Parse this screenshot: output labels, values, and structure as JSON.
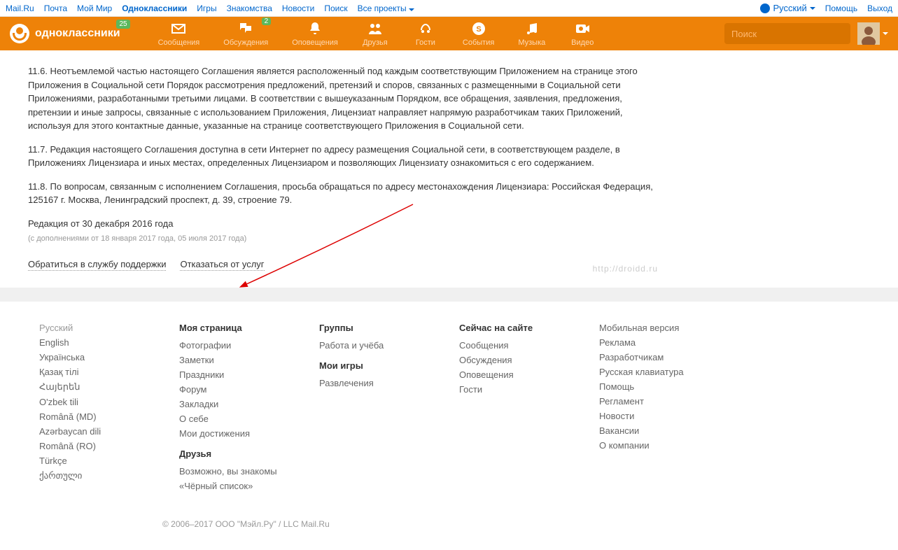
{
  "topbar": {
    "left": [
      "Mail.Ru",
      "Почта",
      "Мой Мир",
      "Одноклассники",
      "Игры",
      "Знакомства",
      "Новости",
      "Поиск",
      "Все проекты"
    ],
    "active_index": 3,
    "dropdown_index": 8,
    "right": {
      "lang": "Русский",
      "help": "Помощь",
      "exit": "Выход"
    }
  },
  "header": {
    "logo_text": "одноклассники",
    "logo_badge": "25",
    "nav": [
      {
        "label": "Сообщения",
        "icon": "mail",
        "badge": null
      },
      {
        "label": "Обсуждения",
        "icon": "chat",
        "badge": "2"
      },
      {
        "label": "Оповещения",
        "icon": "bell",
        "badge": null
      },
      {
        "label": "Друзья",
        "icon": "friends",
        "badge": null
      },
      {
        "label": "Гости",
        "icon": "guests",
        "badge": null
      },
      {
        "label": "События",
        "icon": "events",
        "badge": null
      },
      {
        "label": "Музыка",
        "icon": "music",
        "badge": null
      },
      {
        "label": "Видео",
        "icon": "video",
        "badge": null
      }
    ],
    "search_placeholder": "Поиск"
  },
  "content": {
    "paragraphs": [
      "11.6. Неотъемлемой частью настоящего Соглашения является расположенный под каждым соответствующим Приложением на странице этого Приложения в Социальной сети Порядок рассмотрения предложений, претензий и споров, связанных с размещенными в Социальной сети Приложениями, разработанными третьими лицами. В соответствии с вышеуказанным Порядком, все обращения, заявления, предложения, претензии и иные запросы, связанные с использованием Приложения, Лицензиат направляет напрямую разработчикам таких Приложений, используя для этого контактные данные, указанные на странице соответствующего Приложения в Социальной сети.",
      "11.7. Редакция настоящего Соглашения доступна в сети Интернет по адресу размещения Социальной сети, в соответствующем разделе, в Приложениях Лицензиара и иных местах, определенных Лицензиаром и позволяющих Лицензиату ознакомиться с его содержанием.",
      "11.8. По вопросам, связанным с исполнением Соглашения, просьба обращаться по адресу местонахождения Лицензиара: Российская Федерация, 125167 г. Москва, Ленинградский проспект, д. 39, строение 79."
    ],
    "date_main": "Редакция от 30 декабря 2016 года",
    "date_sub": "(с дополнениями от 18 января 2017 года, 05 июля 2017 года)",
    "actions": [
      "Обратиться в службу поддержки",
      "Отказаться от услуг"
    ],
    "watermark": "http://droidd.ru"
  },
  "footer": {
    "col1": {
      "current": "Русский",
      "links": [
        "English",
        "Українська",
        "Қазақ тілі",
        "Հայերեն",
        "O'zbek tili",
        "Română (MD)",
        "Azərbaycan dili",
        "Română (RO)",
        "Türkçe",
        "ქართული"
      ]
    },
    "col2": {
      "h1": "Моя страница",
      "links1": [
        "Фотографии",
        "Заметки",
        "Праздники",
        "Форум",
        "Закладки",
        "О себе",
        "Мои достижения"
      ],
      "h2": "Друзья",
      "links2": [
        "Возможно, вы знакомы",
        "«Чёрный список»"
      ]
    },
    "col3": {
      "h1": "Группы",
      "links1": [
        "Работа и учёба"
      ],
      "h2": "Мои игры",
      "links2": [
        "Развлечения"
      ]
    },
    "col4": {
      "h1": "Сейчас на сайте",
      "links1": [
        "Сообщения",
        "Обсуждения",
        "Оповещения",
        "Гости"
      ]
    },
    "col5": {
      "links": [
        "Мобильная версия",
        "Реклама",
        "Разработчикам",
        "Русская клавиатура",
        "Помощь",
        "Регламент",
        "Новости",
        "Вакансии",
        "О компании"
      ]
    },
    "copyright": "© 2006–2017 ООО \"Мэйл.Ру\" / LLC Mail.Ru"
  }
}
